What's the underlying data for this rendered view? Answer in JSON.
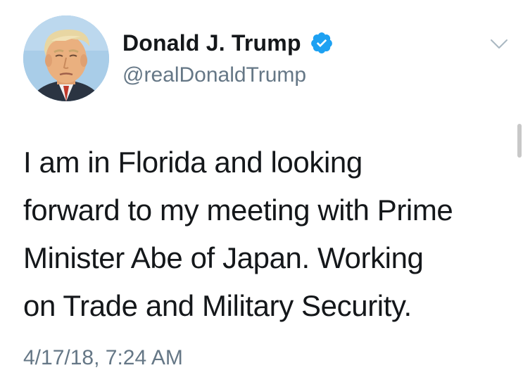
{
  "tweet": {
    "display_name": "Donald J. Trump",
    "handle": "@realDonaldTrump",
    "verified": true,
    "text_lines": [
      "I am in Florida and looking",
      "forward to my meeting with Prime",
      "Minister Abe of Japan. Working",
      "on Trade and Military Security."
    ],
    "timestamp": "4/17/18, 7:24 AM"
  },
  "icons": {
    "verified": "verified-badge-icon",
    "menu": "chevron-down-icon"
  },
  "colors": {
    "text": "#14171a",
    "secondary_text": "#657786",
    "verified_blue": "#1da1f2",
    "caret": "#aab8c2",
    "background": "#ffffff"
  }
}
